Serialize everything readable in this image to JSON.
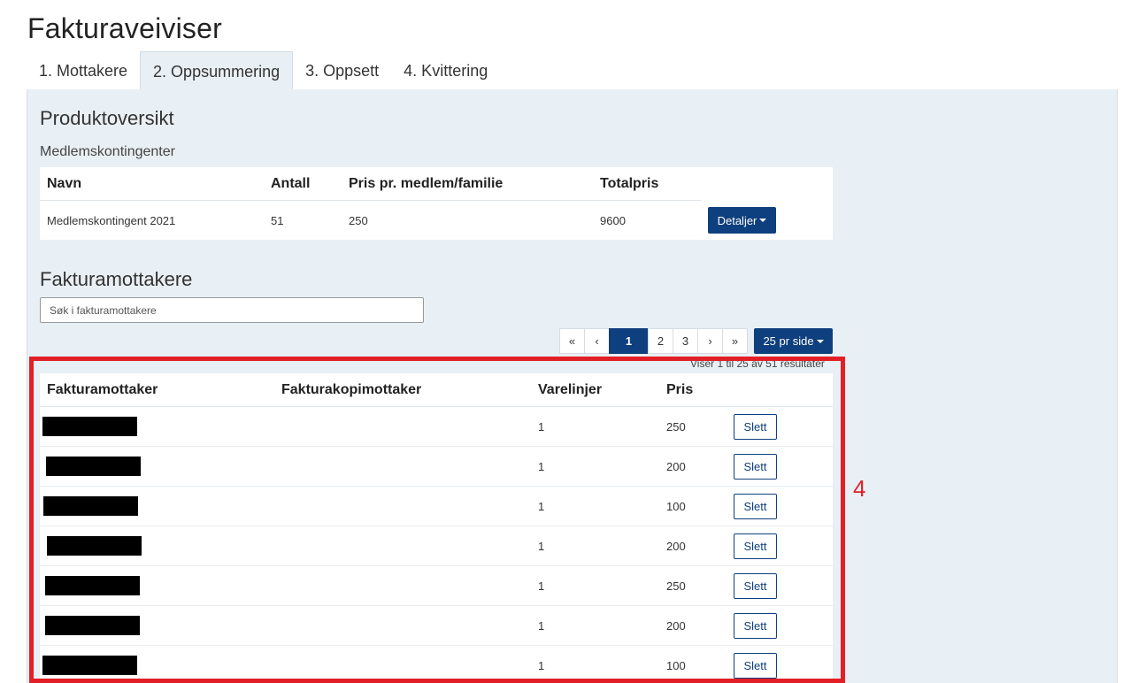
{
  "page_title": "Fakturaveiviser",
  "tabs": [
    {
      "label": "1. Mottakere"
    },
    {
      "label": "2. Oppsummering"
    },
    {
      "label": "3. Oppsett"
    },
    {
      "label": "4. Kvittering"
    }
  ],
  "active_tab": 1,
  "product_overview": {
    "heading": "Produktoversikt",
    "subheading": "Medlemskontingenter",
    "columns": [
      "Navn",
      "Antall",
      "Pris pr. medlem/familie",
      "Totalpris"
    ],
    "rows": [
      {
        "name": "Medlemskontingent 2021",
        "count": "51",
        "price": "250",
        "total": "9600",
        "details_label": "Detaljer"
      }
    ]
  },
  "recipients": {
    "heading": "Fakturamottakere",
    "search_placeholder": "Søk i fakturamottakere",
    "pagination": {
      "first": "«",
      "prev": "‹",
      "pages": [
        "1",
        "2",
        "3"
      ],
      "current": "1",
      "next": "›",
      "last": "»",
      "page_size_label": "25 pr side"
    },
    "result_info": "Viser 1 til 25 av 51 resultater",
    "columns": [
      "Fakturamottaker",
      "Fakturakopimottaker",
      "Varelinjer",
      "Pris"
    ],
    "delete_label": "Slett",
    "rows": [
      {
        "lines": "1",
        "price": "250"
      },
      {
        "lines": "1",
        "price": "200"
      },
      {
        "lines": "1",
        "price": "100"
      },
      {
        "lines": "1",
        "price": "200"
      },
      {
        "lines": "1",
        "price": "250"
      },
      {
        "lines": "1",
        "price": "200"
      },
      {
        "lines": "1",
        "price": "100"
      }
    ]
  },
  "annotation": {
    "label": "4",
    "color": "#e21f26"
  },
  "colors": {
    "primary": "#0e3f7e",
    "panel": "#e8f0f5",
    "highlight": "#e21f26"
  }
}
